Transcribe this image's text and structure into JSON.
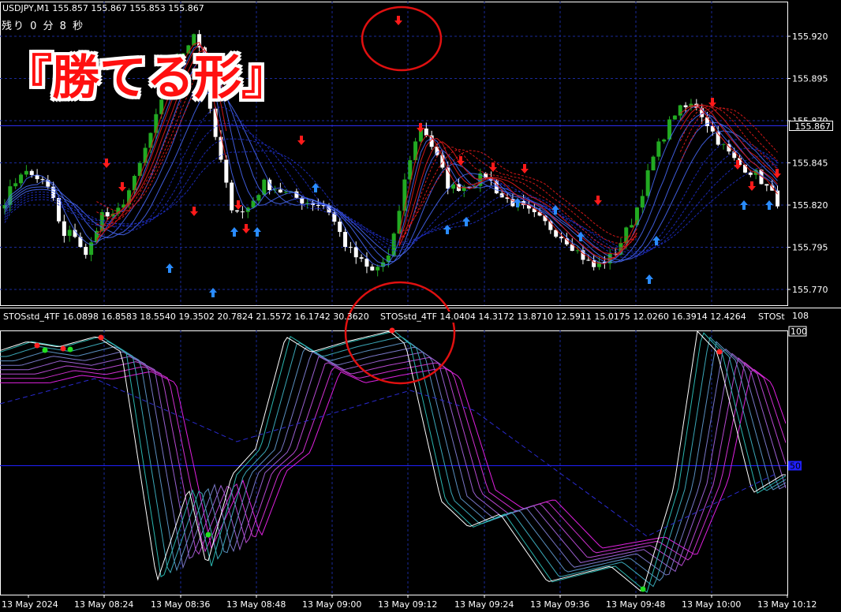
{
  "symbol_header": "USDJPY,M1  155.857 155.867 155.853 155.867",
  "timer_text": "残り  0  分  8  秒",
  "promo_text": "『勝てる形』",
  "indicator_header": "STOSstd_4TF 16.0898 16.8583 18.5540 19.3502 20.7824 21.5572 16.1742 30.3620",
  "indicator_header2": "STOSstd_4TF 14.0404 14.3172 13.8710 12.5911 15.0175 12.0260 16.3914 12.4264",
  "indicator_header3": "STOSt",
  "colors": {
    "up": "#22aa22",
    "down": "#ffffff",
    "grid": "#1a2a9a",
    "sell_arrow": "#ff1a1a",
    "buy_arrow": "#2a8cff",
    "circle": "#e01010"
  },
  "chart_data": [
    {
      "type": "candlestick",
      "title": "USDJPY,M1",
      "y_ticks": [
        "155.920",
        "155.895",
        "155.870",
        "155.845",
        "155.820",
        "155.795",
        "155.770"
      ],
      "ylim": [
        155.765,
        155.935
      ],
      "current_price_label": "155.867",
      "current_price": 155.867,
      "grid": true
    },
    {
      "type": "line",
      "title": "STOSstd_4TF",
      "y_ticks": [
        "108",
        "100",
        "50"
      ],
      "ylim": [
        0,
        108
      ],
      "grid": true
    }
  ],
  "x_ticks": [
    "13 May 2024",
    "13 May 08:24",
    "13 May 08:36",
    "13 May 08:48",
    "13 May 09:00",
    "13 May 09:12",
    "13 May 09:24",
    "13 May 09:36",
    "13 May 09:48",
    "13 May 10:00",
    "13 May 10:12"
  ]
}
